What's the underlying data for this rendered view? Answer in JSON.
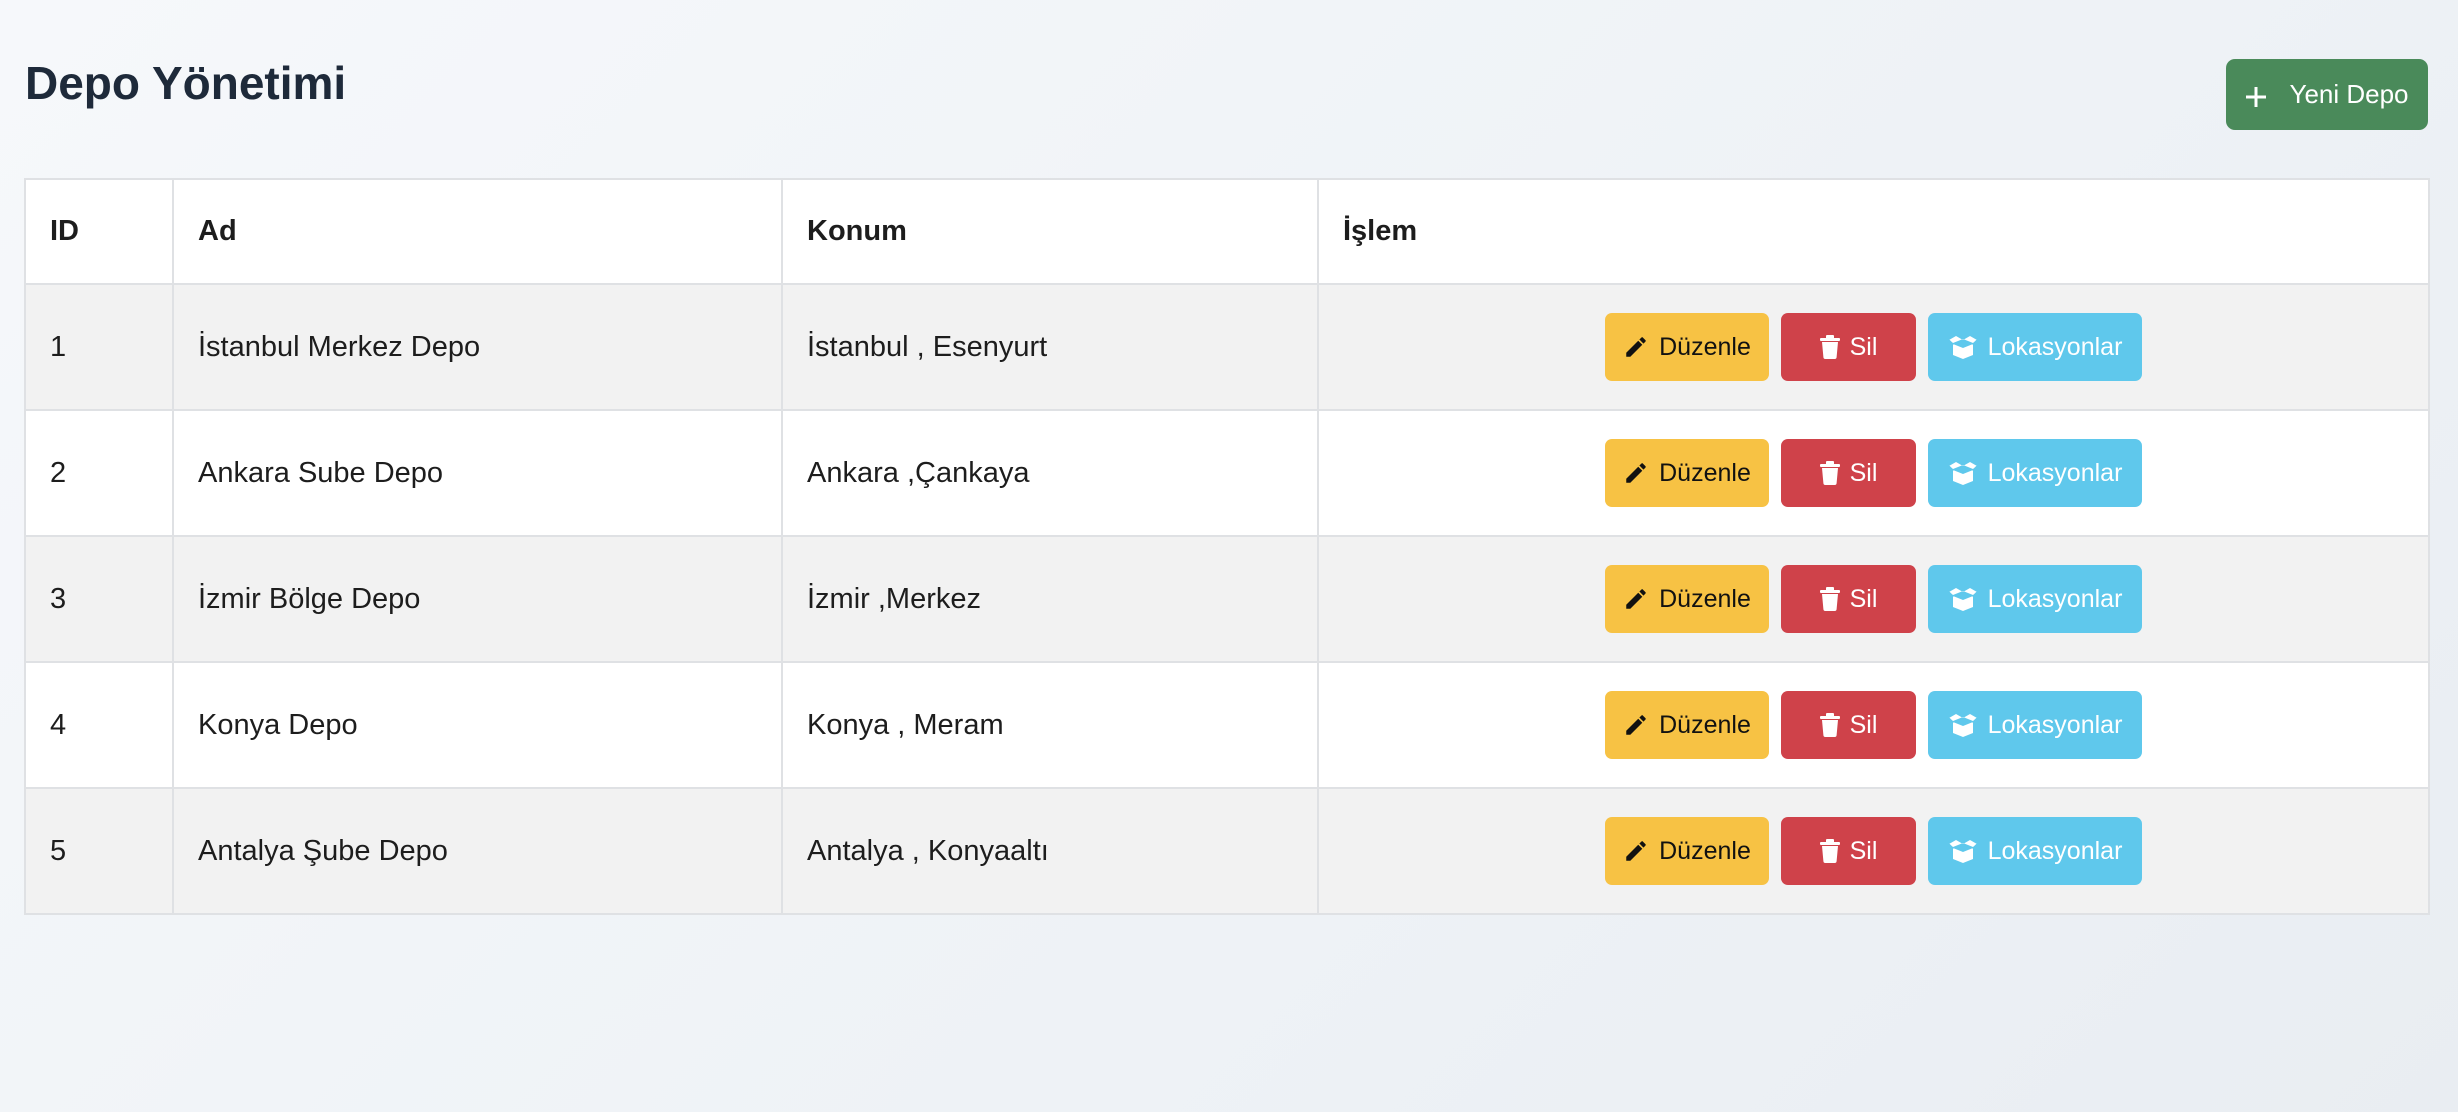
{
  "header": {
    "title": "Depo Yönetimi",
    "new_button_label": "Yeni Depo"
  },
  "table": {
    "columns": [
      "ID",
      "Ad",
      "Konum",
      "İşlem"
    ],
    "rows": [
      {
        "id": "1",
        "name": "İstanbul Merkez Depo",
        "location": "İstanbul , Esenyurt"
      },
      {
        "id": "2",
        "name": "Ankara Sube Depo",
        "location": "Ankara ,Çankaya"
      },
      {
        "id": "3",
        "name": "İzmir Bölge Depo",
        "location": "İzmir ,Merkez"
      },
      {
        "id": "4",
        "name": "Konya Depo",
        "location": "Konya , Meram"
      },
      {
        "id": "5",
        "name": "Antalya Şube Depo",
        "location": "Antalya , Konyaaltı"
      }
    ]
  },
  "actions": {
    "edit_label": "Düzenle",
    "delete_label": "Sil",
    "locations_label": "Lokasyonlar"
  },
  "icons": {
    "new": "plus-icon",
    "edit": "pencil-icon",
    "delete": "trash-icon",
    "locations": "box-open-icon"
  },
  "colors": {
    "new_button": "#4a8a5a",
    "edit_button": "#f7c244",
    "delete_button": "#cf424a",
    "locations_button": "#5fc8ec",
    "title": "#1e2a3a"
  }
}
